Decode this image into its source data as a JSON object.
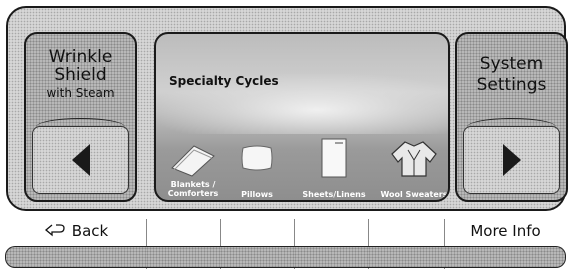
{
  "left_button": {
    "title": "Wrinkle\nShield",
    "subtitle": "with Steam",
    "arrow_icon": "triangle-left-icon"
  },
  "right_button": {
    "title": "System\nSettings",
    "arrow_icon": "triangle-right-icon"
  },
  "screen": {
    "title": "Specialty Cycles",
    "cycles": [
      {
        "label": "Blankets /\nComforters",
        "icon": "blanket-icon"
      },
      {
        "label": "Pillows",
        "icon": "pillow-icon"
      },
      {
        "label": "Sheets/Linens",
        "icon": "sheets-icon"
      },
      {
        "label": "Wool Sweaters",
        "icon": "sweater-icon"
      }
    ]
  },
  "bottom_bar": {
    "back_label": "Back",
    "back_icon": "back-arrow-icon",
    "more_info_label": "More Info"
  }
}
